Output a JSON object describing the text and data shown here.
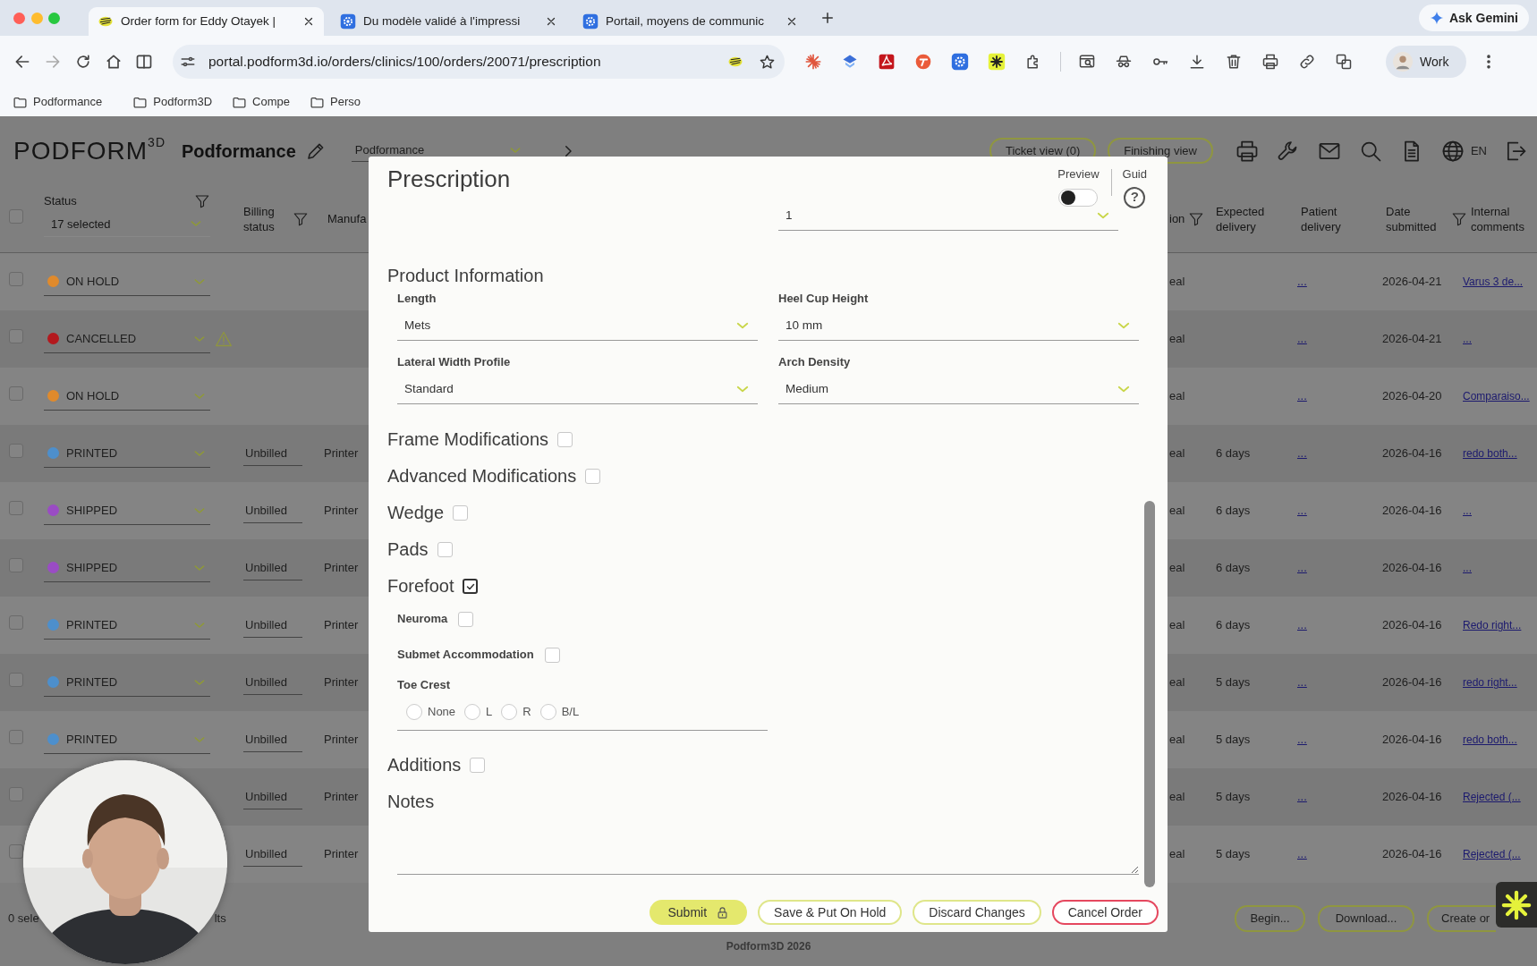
{
  "browser": {
    "tabs": [
      {
        "title": "Order form for Eddy Otayek |",
        "selected": true
      },
      {
        "title": "Du modèle validé à l'impressi",
        "selected": false
      },
      {
        "title": "Portail, moyens de communic",
        "selected": false
      }
    ],
    "ask_gemini": "Ask Gemini",
    "url": "portal.podform3d.io/orders/clinics/100/orders/20071/prescription",
    "profile": "Work",
    "bookmarks": [
      "Podformance",
      "Podform3D",
      "Compe",
      "Perso"
    ]
  },
  "header": {
    "logo": "PODFORM$^{3D}$",
    "organization": "Podformance",
    "organization_select": "Podformance",
    "view_buttons": [
      "Ticket view (0)",
      "Finishing view"
    ],
    "language": "EN"
  },
  "table": {
    "status_filter": "17 selected",
    "all_checked": false,
    "columns": [
      {
        "label": "Status",
        "filter": true
      },
      {
        "label": "Billing status",
        "filter": true
      },
      {
        "label": "Manufa",
        "filter": false
      },
      {
        "label": "ion",
        "filter": true
      },
      {
        "label": "Expected delivery",
        "filter": false
      },
      {
        "label": "Patient delivery",
        "filter": false
      },
      {
        "label": "Date submitted",
        "filter": true
      },
      {
        "label": "Internal comments",
        "filter": false
      }
    ],
    "rows": [
      {
        "checked": false,
        "status": "ON HOLD",
        "color": "#e08a2c",
        "warning": false,
        "column_4": "eal",
        "patient_delivery": "...",
        "date_submitted": "2026-04-21",
        "internal_comments": "Varus 3 de..."
      },
      {
        "checked": false,
        "status": "CANCELLED",
        "color": "#b3191e",
        "warning": true,
        "column_4": "eal",
        "patient_delivery": "...",
        "date_submitted": "2026-04-21",
        "internal_comments": "..."
      },
      {
        "checked": false,
        "status": "ON HOLD",
        "color": "#e08a2c",
        "warning": false,
        "column_4": "eal",
        "patient_delivery": "...",
        "date_submitted": "2026-04-20",
        "internal_comments": "Comparaiso..."
      },
      {
        "checked": false,
        "status": "PRINTED",
        "color": "#4d8fcc",
        "warning": false,
        "billing": "Unbilled",
        "manufacturer": "Printer",
        "column_4": "eal",
        "expected_delivery": "6 days",
        "patient_delivery": "...",
        "date_submitted": "2026-04-16",
        "internal_comments": "redo both..."
      },
      {
        "checked": false,
        "status": "SHIPPED",
        "color": "#9a4cc4",
        "warning": false,
        "billing": "Unbilled",
        "manufacturer": "Printer",
        "column_4": "eal",
        "expected_delivery": "6 days",
        "patient_delivery": "...",
        "date_submitted": "2026-04-16",
        "internal_comments": "..."
      },
      {
        "checked": false,
        "status": "SHIPPED",
        "color": "#9a4cc4",
        "warning": false,
        "billing": "Unbilled",
        "manufacturer": "Printer",
        "column_4": "eal",
        "expected_delivery": "6 days",
        "patient_delivery": "...",
        "date_submitted": "2026-04-16",
        "internal_comments": "..."
      },
      {
        "checked": false,
        "status": "PRINTED",
        "color": "#4d8fcc",
        "warning": false,
        "billing": "Unbilled",
        "manufacturer": "Printer",
        "column_4": "eal",
        "expected_delivery": "6 days",
        "patient_delivery": "...",
        "date_submitted": "2026-04-16",
        "internal_comments": "Redo right..."
      },
      {
        "checked": false,
        "status": "PRINTED",
        "color": "#4d8fcc",
        "warning": false,
        "billing": "Unbilled",
        "manufacturer": "Printer",
        "column_4": "eal",
        "expected_delivery": "5 days",
        "patient_delivery": "...",
        "date_submitted": "2026-04-16",
        "internal_comments": "redo right..."
      },
      {
        "checked": false,
        "status": "PRINTED",
        "color": "#4d8fcc",
        "warning": false,
        "billing": "Unbilled",
        "manufacturer": "Printer",
        "column_4": "eal",
        "expected_delivery": "5 days",
        "patient_delivery": "...",
        "date_submitted": "2026-04-16",
        "internal_comments": "redo both..."
      },
      {
        "checked": false,
        "warning": false,
        "billing": "Unbilled",
        "manufacturer": "Printer",
        "column_4": "eal",
        "expected_delivery": "5 days",
        "patient_delivery": "...",
        "date_submitted": "2026-04-16",
        "internal_comments": "Rejected (..."
      },
      {
        "checked": false,
        "warning": false,
        "billing": "Unbilled",
        "manufacturer": "Printer",
        "column_4": "eal",
        "expected_delivery": "5 days",
        "patient_delivery": "...",
        "date_submitted": "2026-04-16",
        "internal_comments": "Rejected (..."
      }
    ]
  },
  "footer": {
    "selection": "0 sele",
    "results": "lts",
    "buttons": [
      "Begin...",
      "Download...",
      "Create or"
    ],
    "copyright": "Podform3D 2026"
  },
  "modal": {
    "title": "Prescription",
    "preview": {
      "label": "Preview",
      "on": false
    },
    "guide": {
      "label": "Guid",
      "icon_text": "?"
    },
    "top_select": "1",
    "section_title": "Product Information",
    "fields": [
      {
        "label": "Length",
        "value": "Mets"
      },
      {
        "label": "Heel Cup Height",
        "value": "10 mm"
      },
      {
        "label": "Lateral Width Profile",
        "value": "Standard"
      },
      {
        "label": "Arch Density",
        "value": "Medium"
      }
    ],
    "sections": [
      {
        "label": "Frame Modifications",
        "checked": false
      },
      {
        "label": "Advanced Modifications",
        "checked": false
      },
      {
        "label": "Wedge",
        "checked": false
      },
      {
        "label": "Pads",
        "checked": false
      },
      {
        "label": "Forefoot",
        "checked": true,
        "children": [
          {
            "kind": "checkbox",
            "label": "Neuroma",
            "checked": false
          },
          {
            "kind": "checkbox",
            "label": "Submet Accommodation",
            "checked": false
          },
          {
            "kind": "radio_group",
            "label": "Toe Crest",
            "options": [
              {
                "label": "None",
                "selected": false
              },
              {
                "label": "L",
                "selected": false
              },
              {
                "label": "R",
                "selected": false
              },
              {
                "label": "B/L",
                "selected": false
              }
            ]
          }
        ]
      },
      {
        "label": "Additions",
        "checked": false
      }
    ],
    "notes_label": "Notes",
    "buttons": [
      {
        "label": "Submit",
        "kind": "primary",
        "locked": true
      },
      {
        "label": "Save & Put On Hold",
        "kind": "outline",
        "locked": false
      },
      {
        "label": "Discard Changes",
        "kind": "outline",
        "locked": false
      },
      {
        "label": "Cancel Order",
        "kind": "danger",
        "locked": false
      }
    ]
  }
}
